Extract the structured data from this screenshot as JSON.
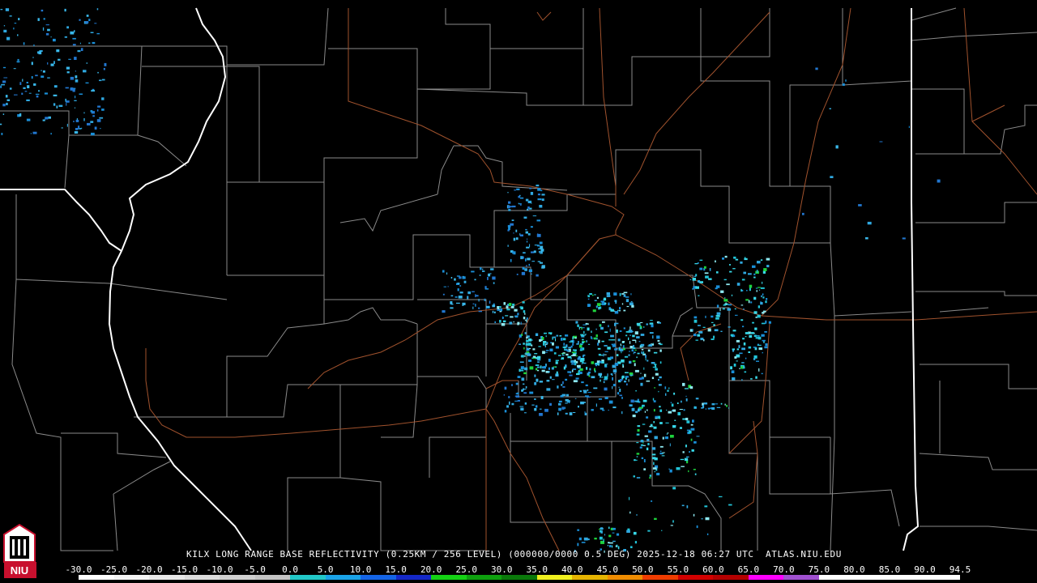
{
  "product": {
    "caption": "KILX LONG RANGE BASE REFLECTIVITY (0.25KM / 256 LEVEL) (000000/0000 0.5 DEG) 2025-12-18 06:27 UTC  ATLAS.NIU.EDU"
  },
  "logo": {
    "text": "NIU"
  },
  "colors": {
    "background": "#000000",
    "county_lines": "#8a8a8a",
    "state_lines": "#ffffff",
    "highways": "#a0522d",
    "light_echo": "#2fa8e0",
    "moderate_echo": "#22c4d8",
    "strong_echo": "#1ed23c"
  },
  "legend": {
    "labels": [
      "-30.0",
      "-25.0",
      "-20.0",
      "-15.0",
      "-10.0",
      "-5.0",
      "0.0",
      "5.0",
      "10.0",
      "15.0",
      "20.0",
      "25.0",
      "30.0",
      "35.0",
      "40.0",
      "45.0",
      "50.0",
      "55.0",
      "60.0",
      "65.0",
      "70.0",
      "75.0",
      "80.0",
      "85.0",
      "90.0",
      "94.5"
    ],
    "colors": [
      "#ffffff",
      "#f4f4f4",
      "#e8e8e8",
      "#dcdcdc",
      "#d0d0d0",
      "#c4c4c4",
      "#22c8c8",
      "#1aa3e8",
      "#1464e6",
      "#1428c8",
      "#14d214",
      "#0ea00e",
      "#0a780a",
      "#f0f01e",
      "#e6b400",
      "#f08c00",
      "#f03c00",
      "#d20000",
      "#b40000",
      "#ff00ff",
      "#a050d0",
      "#ffffff",
      "#ffffff",
      "#ffffff",
      "#ffffff"
    ]
  },
  "echoes": [
    {
      "area": "northwest",
      "x": [
        0,
        130
      ],
      "y": [
        10,
        165
      ],
      "count": 160,
      "level": "light"
    },
    {
      "area": "north-spike",
      "x": [
        625,
        670
      ],
      "y": [
        228,
        340
      ],
      "count": 90,
      "level": "light"
    },
    {
      "area": "west-band",
      "x": [
        545,
        610
      ],
      "y": [
        330,
        385
      ],
      "count": 60,
      "level": "light"
    },
    {
      "area": "west-center",
      "x": [
        610,
        650
      ],
      "y": [
        372,
        400
      ],
      "count": 40,
      "level": "moderate"
    },
    {
      "area": "east-center",
      "x": [
        725,
        780
      ],
      "y": [
        360,
        385
      ],
      "count": 50,
      "level": "moderate"
    },
    {
      "area": "southwest-core",
      "x": [
        640,
        720
      ],
      "y": [
        410,
        460
      ],
      "count": 160,
      "level": "moderate"
    },
    {
      "area": "southeast-core",
      "x": [
        705,
        815
      ],
      "y": [
        395,
        470
      ],
      "count": 220,
      "level": "moderate"
    },
    {
      "area": "south-fringe",
      "x": [
        620,
        790
      ],
      "y": [
        460,
        510
      ],
      "count": 120,
      "level": "light"
    },
    {
      "area": "east-plume",
      "x": [
        850,
        950
      ],
      "y": [
        315,
        420
      ],
      "count": 140,
      "level": "moderate"
    },
    {
      "area": "east-line",
      "x": [
        900,
        945
      ],
      "y": [
        410,
        470
      ],
      "count": 50,
      "level": "moderate"
    },
    {
      "area": "southeast-line",
      "x": [
        780,
        860
      ],
      "y": [
        470,
        590
      ],
      "count": 140,
      "level": "moderate"
    },
    {
      "area": "southeast-spot",
      "x": [
        865,
        900
      ],
      "y": [
        495,
        505
      ],
      "count": 15,
      "level": "moderate"
    },
    {
      "area": "far-south",
      "x": [
        705,
        785
      ],
      "y": [
        650,
        680
      ],
      "count": 40,
      "level": "moderate"
    },
    {
      "area": "southern-strays",
      "x": [
        765,
        900
      ],
      "y": [
        600,
        660
      ],
      "count": 20,
      "level": "moderate"
    },
    {
      "area": "northeast-strays",
      "x": [
        990,
        1200
      ],
      "y": [
        60,
        300
      ],
      "count": 14,
      "level": "light"
    }
  ]
}
